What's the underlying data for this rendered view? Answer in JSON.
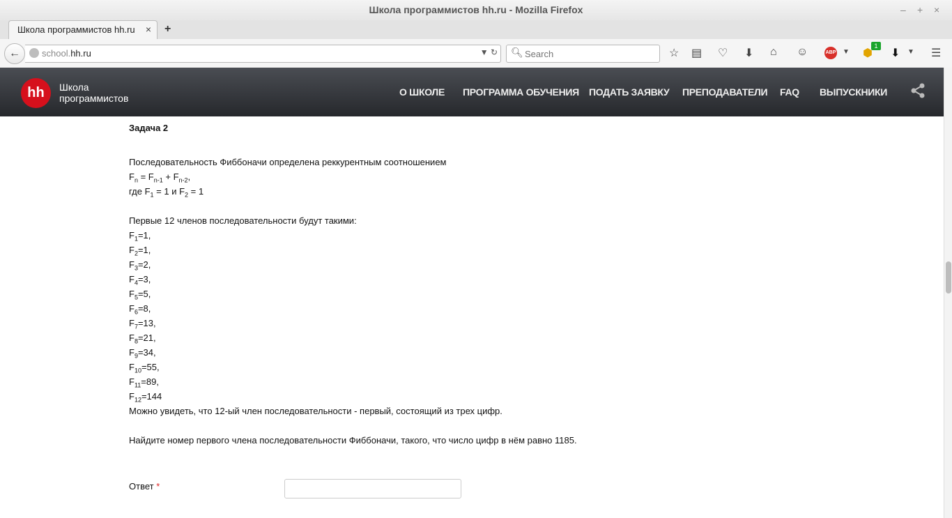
{
  "window": {
    "title": "Школа программистов hh.ru - Mozilla Firefox",
    "controls": [
      "–",
      "+",
      "×"
    ]
  },
  "tab": {
    "label": "Школа программистов hh.ru",
    "close": "×",
    "newtab": "+"
  },
  "nav": {
    "url_prefix": "school.",
    "url_domain": "hh.ru",
    "search_placeholder": "Search",
    "abp_label": "ABP",
    "notification_count": "1"
  },
  "site": {
    "logo": "hh",
    "brand_line1": "Школа",
    "brand_line2": "программистов",
    "menu": [
      "О ШКОЛЕ",
      "ПРОГРАММА ОБУЧЕНИЯ",
      "ПОДАТЬ ЗАЯВКУ",
      "ПРЕПОДАВАТЕЛИ",
      "FAQ",
      "ВЫПУСКНИКИ"
    ]
  },
  "task": {
    "title": "Задача 2",
    "intro": "Последовательность Фиббоначи определена реккурентным соотношением",
    "formula": {
      "f": "F",
      "n": "n",
      "eq": " = F",
      "n1": "n-1",
      "plus": " + F",
      "n2": "n-2",
      "end": ","
    },
    "where": {
      "prefix": "где F",
      "s1": "1",
      "mid": " = 1 и F",
      "s2": "2",
      "end": " = 1"
    },
    "first_terms_label": "Первые 12 членов последовательности будут такими:",
    "terms": [
      {
        "sub": "1",
        "val": "=1,"
      },
      {
        "sub": "2",
        "val": "=1,"
      },
      {
        "sub": "3",
        "val": "=2,"
      },
      {
        "sub": "4",
        "val": "=3,"
      },
      {
        "sub": "5",
        "val": "=5,"
      },
      {
        "sub": "6",
        "val": "=8,"
      },
      {
        "sub": "7",
        "val": "=13,"
      },
      {
        "sub": "8",
        "val": "=21,"
      },
      {
        "sub": "9",
        "val": "=34,"
      },
      {
        "sub": "10",
        "val": "=55,"
      },
      {
        "sub": "11",
        "val": "=89,"
      },
      {
        "sub": "12",
        "val": "=144"
      }
    ],
    "observation": "Можно увидеть, что 12-ый член последовательности - первый, состоящий из трех цифр.",
    "question": "Найдите номер первого члена последовательности Фиббоначи, такого, что число цифр в нём равно 1185.",
    "answer_label": "Ответ",
    "required_mark": "*",
    "answer_value": ""
  }
}
